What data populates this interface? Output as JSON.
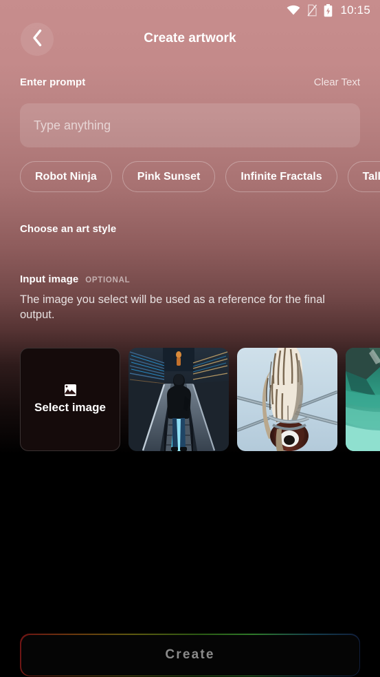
{
  "status_bar": {
    "wifi_icon": "wifi-icon",
    "sim_icon": "no-sim-icon",
    "battery_icon": "battery-charging-icon",
    "time": "10:15"
  },
  "header": {
    "back_icon": "chevron-left-icon",
    "title": "Create artwork"
  },
  "prompt": {
    "label": "Enter prompt",
    "clear_label": "Clear Text",
    "value": "",
    "placeholder": "Type anything",
    "suggestions": [
      {
        "label": "Robot Ninja"
      },
      {
        "label": "Pink Sunset"
      },
      {
        "label": "Infinite Fractals"
      },
      {
        "label": "Tall Bird"
      }
    ]
  },
  "art_style": {
    "title": "Choose an art style"
  },
  "input_image": {
    "title": "Input image",
    "badge": "OPTIONAL",
    "description": "The image you select will be used as a reference for the final output.",
    "select_card": {
      "icon": "image-icon",
      "label": "Select image"
    },
    "thumbnails": [
      {
        "name": "escalator-neon-photo",
        "alt": "Person walking down escalator with blue neon lights"
      },
      {
        "name": "bird-on-powerline-photo",
        "alt": "Bird perched on power line insulator against pale sky"
      },
      {
        "name": "turquoise-lake-boat-photo",
        "alt": "Turquoise mountain lake with wooden boat"
      }
    ]
  },
  "footer": {
    "create_label": "Create"
  },
  "colors": {
    "bg_top": "#c78d8d",
    "bg_bottom": "#000000",
    "text_primary": "#ffffff",
    "create_text": "#8a8a8a",
    "border_gradient_start": "#6e1414",
    "border_gradient_end": "#101c3a"
  }
}
